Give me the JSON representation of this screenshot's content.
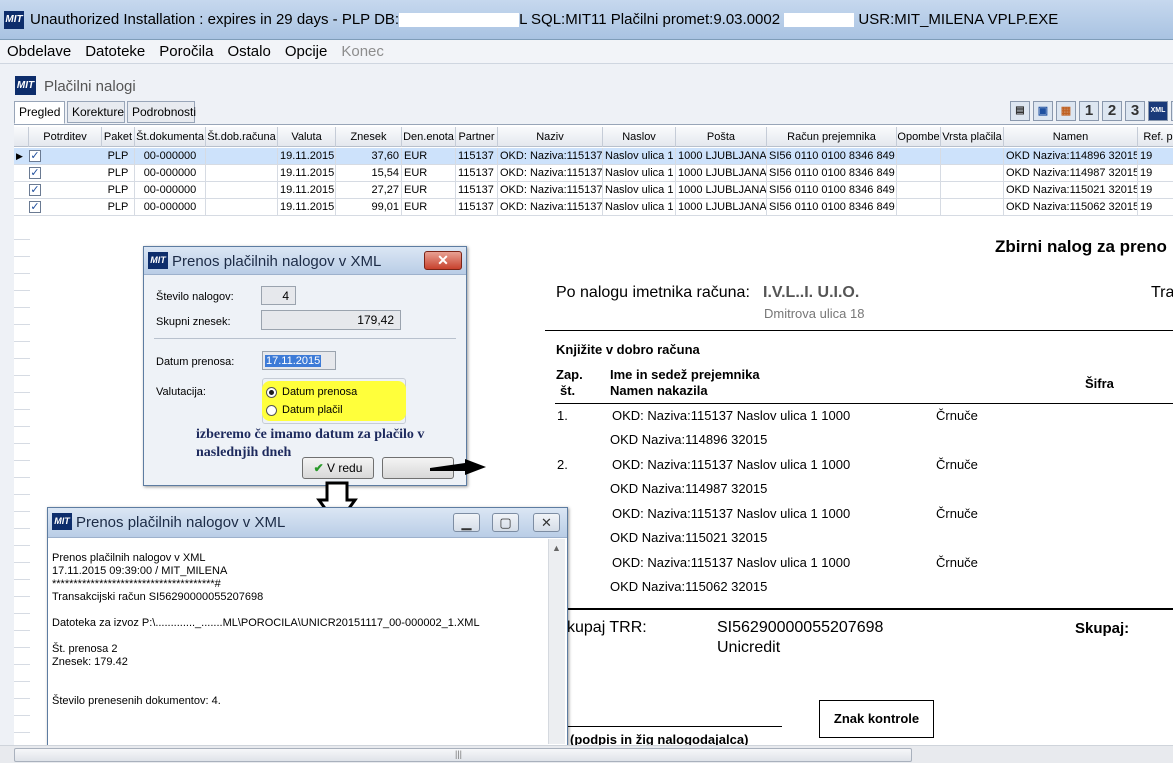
{
  "titlebar": {
    "part1": "Unauthorized Installation : expires in 29 days - PLP  DB:",
    "part2": "L  SQL:MIT11  Plačilni promet:9.03.0002",
    "part3": "USR:MIT_MILENA   VPLP.EXE",
    "icon": "mit-logo-icon"
  },
  "menu": [
    "Obdelave",
    "Datoteke",
    "Poročila",
    "Ostalo",
    "Opcije",
    "Konec"
  ],
  "form": {
    "title": "Plačilni nalogi",
    "tabs": [
      "Pregled",
      "Korekture",
      "Podrobnosti"
    ]
  },
  "toolbar": {
    "icons": [
      "preview-icon",
      "print-icon",
      "export-icon",
      "page-1-icon",
      "page-2-icon",
      "page-3-icon",
      "xml-icon",
      "more-icon"
    ],
    "nums": [
      "1",
      "2",
      "3"
    ],
    "xml": "XML"
  },
  "grid": {
    "columns": [
      "Potrditev",
      "Paket",
      "Št.dokumenta",
      "Št.dob.računa",
      "Valuta",
      "Znesek",
      "Den.enota",
      "Partner",
      "Naziv",
      "Naslov",
      "Pošta",
      "Račun prejemnika",
      "Opombe",
      "Vrsta plačila",
      "Namen",
      "Ref. p"
    ],
    "rows": [
      {
        "paket": "PLP",
        "dok": "00-000000",
        "valuta": "19.11.2015",
        "znesek": "37,60",
        "den": "EUR",
        "partner": "115137",
        "naziv": "OKD: Naziva:115137",
        "naslov": "Naslov ulica 1",
        "posta": "1000 LJUBLJANA",
        "racun": "SI56 0110 0100 8346 849",
        "namen": "OKD Naziva:114896 32015",
        "ref": "19"
      },
      {
        "paket": "PLP",
        "dok": "00-000000",
        "valuta": "19.11.2015",
        "znesek": "15,54",
        "den": "EUR",
        "partner": "115137",
        "naziv": "OKD: Naziva:115137",
        "naslov": "Naslov ulica 1",
        "posta": "1000 LJUBLJANA",
        "racun": "SI56 0110 0100 8346 849",
        "namen": "OKD Naziva:114987 32015",
        "ref": "19"
      },
      {
        "paket": "PLP",
        "dok": "00-000000",
        "valuta": "19.11.2015",
        "znesek": "27,27",
        "den": "EUR",
        "partner": "115137",
        "naziv": "OKD: Naziva:115137",
        "naslov": "Naslov ulica 1",
        "posta": "1000 LJUBLJANA",
        "racun": "SI56 0110 0100 8346 849",
        "namen": "OKD Naziva:115021 32015",
        "ref": "19"
      },
      {
        "paket": "PLP",
        "dok": "00-000000",
        "valuta": "19.11.2015",
        "znesek": "99,01",
        "den": "EUR",
        "partner": "115137",
        "naziv": "OKD: Naziva:115137",
        "naslov": "Naslov ulica 1",
        "posta": "1000 LJUBLJANA",
        "racun": "SI56 0110 0100 8346 849",
        "namen": "OKD Naziva:115062 32015",
        "ref": "19"
      }
    ]
  },
  "report": {
    "heading": "Zbirni nalog za preno",
    "po_nalogu": "Po nalogu imetnika računa:",
    "imetnik_partial": "I.V.L..I. U.I.O.",
    "address_partial": "Dmitrova ulica 18",
    "tra": "Tra",
    "knjizite": "Knjižite v dobro računa",
    "zap": "Zap.",
    "st": "št.",
    "ime": "Ime in sedež prejemnika",
    "namen": "Namen nakazila",
    "sifra": "Šifra",
    "items": [
      {
        "nr": "1.",
        "line": "OKD: Naziva:115137 Naslov ulica 1 1000",
        "city": "Črnuče",
        "namen": "OKD Naziva:114896 32015"
      },
      {
        "nr": "2.",
        "line": "OKD: Naziva:115137 Naslov ulica 1 1000",
        "city": "Črnuče",
        "namen": "OKD Naziva:114987 32015"
      },
      {
        "nr": "",
        "line": "OKD: Naziva:115137 Naslov ulica 1 1000",
        "city": "Črnuče",
        "namen": "OKD Naziva:115021 32015"
      },
      {
        "nr": "",
        "line": "OKD: Naziva:115137 Naslov ulica 1 1000",
        "city": "Črnuče",
        "namen": "OKD Naziva:115062 32015"
      }
    ],
    "skupaj_trr": "kupaj TRR:",
    "trr": "SI56290000055207698",
    "bank": "Unicredit",
    "skupaj": "Skupaj:",
    "znak": "Znak kontrole",
    "podpis": "(podpis in žig nalogodajalca)"
  },
  "dialog1": {
    "title": "Prenos plačilnih nalogov v XML",
    "close": "✕",
    "stevilo_label": "Število nalogov:",
    "stevilo": "4",
    "znesek_label": "Skupni znesek:",
    "znesek": "179,42",
    "datum_label": "Datum prenosa:",
    "datum": "17.11.2015",
    "valutacija_label": "Valutacija:",
    "opt1": "Datum prenosa",
    "opt2": "Datum plačil",
    "note": "izberemo če imamo datum za plačilo v naslednjih dneh",
    "ok": "V redu",
    "ok_icon": "✔"
  },
  "dialog2": {
    "title": "Prenos plačilnih nalogov v XML",
    "minimize": "▁",
    "maximize": "▢",
    "close": "✕",
    "log": [
      "Prenos plačilnih nalogov v XML",
      "17.11.2015 09:39:00 / MIT_MILENA",
      "**************************************#",
      "Transakcijski račun SI56290000055207698",
      "",
      "Datoteka za izvoz P:\\............._.......ML\\POROCILA\\UNICR20151117_00-000002_1.XML",
      "",
      "Št. prenosa     2",
      "Znesek: 179.42",
      "",
      "",
      "Število prenesenih dokumentov: 4."
    ]
  },
  "scrollbar": {
    "grip": "|||"
  }
}
